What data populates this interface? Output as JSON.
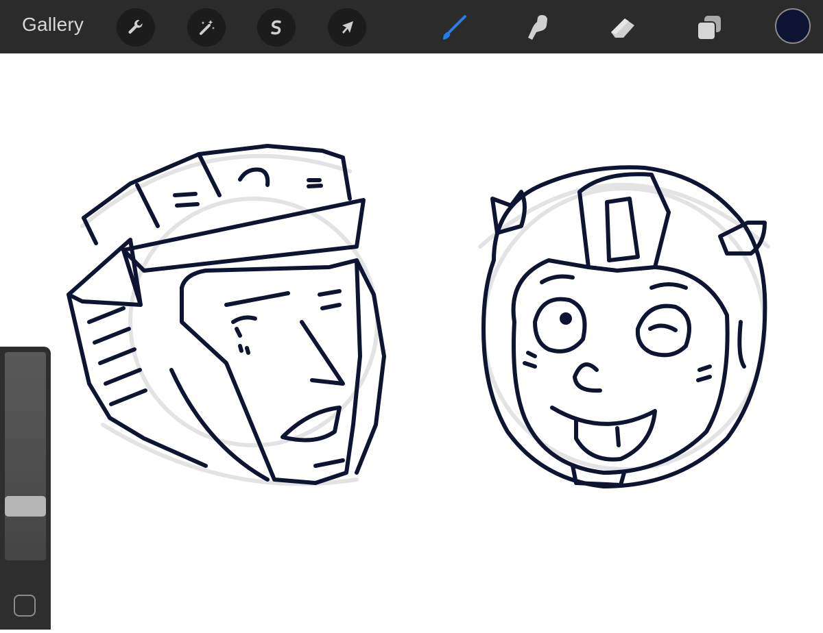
{
  "toolbar": {
    "gallery_label": "Gallery",
    "actions_icon": "wrench-icon",
    "adjustments_icon": "magic-wand-icon",
    "selection_icon": "selection-s-icon",
    "transform_icon": "arrow-cursor-icon",
    "brush_icon": "brush-icon",
    "smudge_icon": "smudge-finger-icon",
    "eraser_icon": "eraser-icon",
    "layers_icon": "layers-icon",
    "active_tool": "brush",
    "current_color": "#0d1533",
    "active_tool_color": "#1f7ff0"
  },
  "sidebar": {
    "brush_size_slider": "brush-size-slider",
    "modify_button_icon": "square-icon"
  },
  "canvas": {
    "ink_color": "#0d1533",
    "sketch_color": "#e3e3e6"
  }
}
